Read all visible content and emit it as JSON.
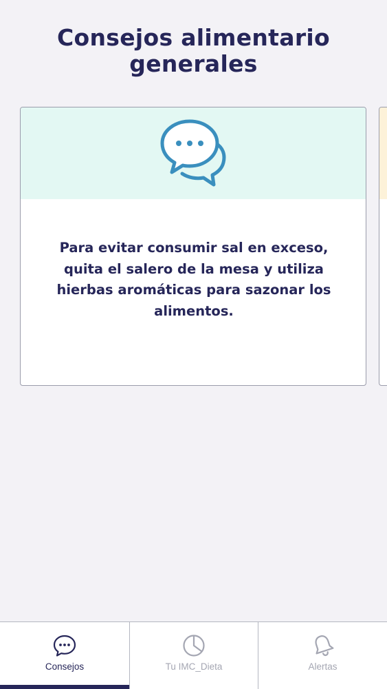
{
  "page": {
    "title": "Consejos alimentario generales"
  },
  "card": {
    "icon": "chat-bubbles-icon",
    "text": "Para evitar consumir sal en exceso, quita el salero de la mesa y utiliza hierbas aromáticas para sazonar los alimentos."
  },
  "tabs": [
    {
      "label": "Consejos",
      "icon": "chat-bubble-icon",
      "active": true
    },
    {
      "label": "Tu IMC_Dieta",
      "icon": "pie-chart-icon",
      "active": false
    },
    {
      "label": "Alertas",
      "icon": "bell-icon",
      "active": false
    }
  ],
  "colors": {
    "background": "#f3f2f6",
    "text_primary": "#262659",
    "icon_blue": "#3a8fbe",
    "card_header_mint": "#e3f8f3",
    "card_header_peach": "#fdf2d9",
    "tab_inactive": "#a4a6b2"
  }
}
